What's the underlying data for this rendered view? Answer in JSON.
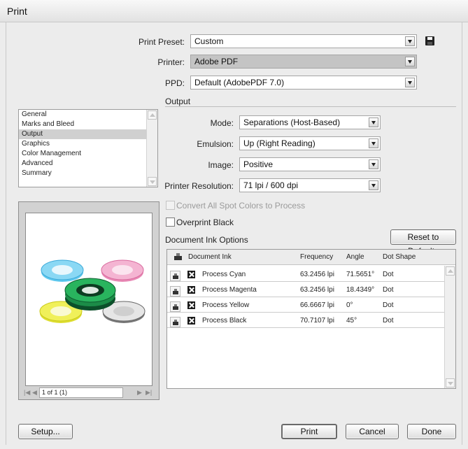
{
  "window": {
    "title": "Print"
  },
  "top": {
    "print_preset": {
      "label": "Print Preset:",
      "value": "Custom"
    },
    "printer": {
      "label": "Printer:",
      "value": "Adobe PDF"
    },
    "ppd": {
      "label": "PPD:",
      "value": "Default (AdobePDF 7.0)"
    },
    "save_icon": "save-icon"
  },
  "sidebar": {
    "items": [
      {
        "label": "General"
      },
      {
        "label": "Marks and Bleed"
      },
      {
        "label": "Output",
        "selected": true
      },
      {
        "label": "Graphics"
      },
      {
        "label": "Color Management"
      },
      {
        "label": "Advanced"
      },
      {
        "label": "Summary"
      }
    ]
  },
  "output": {
    "section_title": "Output",
    "mode": {
      "label": "Mode:",
      "value": "Separations (Host-Based)"
    },
    "emulsion": {
      "label": "Emulsion:",
      "value": "Up (Right Reading)"
    },
    "image": {
      "label": "Image:",
      "value": "Positive"
    },
    "resolution": {
      "label": "Printer Resolution:",
      "value": "71 lpi / 600 dpi"
    },
    "convert_spot": {
      "label": "Convert All Spot Colors to Process",
      "checked": false,
      "disabled": true
    },
    "overprint_black": {
      "label": "Overprint Black",
      "checked": false
    }
  },
  "ink_options": {
    "title": "Document Ink Options",
    "reset_button": "Reset to Defaults",
    "columns": [
      "Document Ink",
      "Frequency",
      "Angle",
      "Dot Shape"
    ],
    "rows": [
      {
        "name": "Process Cyan",
        "frequency": "63.2456 lpi",
        "angle": "71.5651°",
        "shape": "Dot"
      },
      {
        "name": "Process Magenta",
        "frequency": "63.2456 lpi",
        "angle": "18.4349°",
        "shape": "Dot"
      },
      {
        "name": "Process Yellow",
        "frequency": "66.6667 lpi",
        "angle": "0°",
        "shape": "Dot"
      },
      {
        "name": "Process Black",
        "frequency": "70.7107 lpi",
        "angle": "45°",
        "shape": "Dot"
      }
    ]
  },
  "preview": {
    "page_indicator": "1 of 1 (1)"
  },
  "buttons": {
    "setup": "Setup...",
    "print": "Print",
    "cancel": "Cancel",
    "done": "Done"
  }
}
